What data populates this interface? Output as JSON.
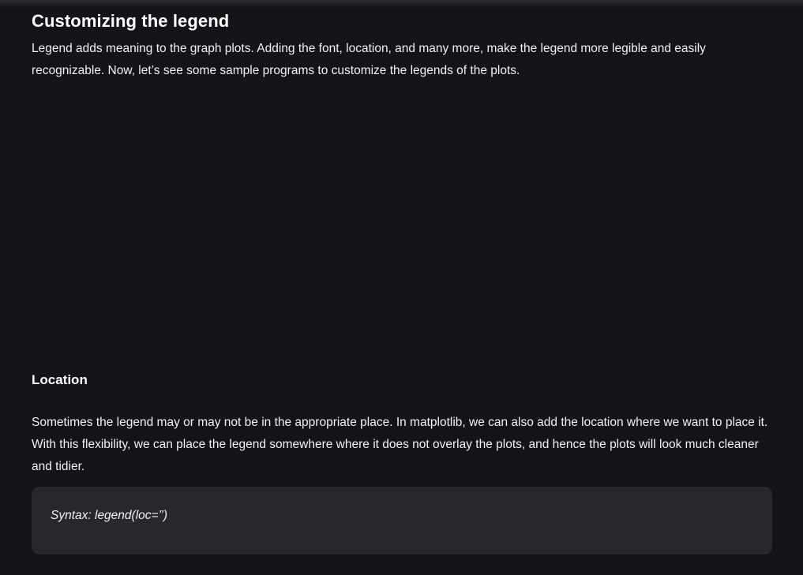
{
  "article": {
    "title": "Customizing the legend",
    "intro": "Legend adds meaning to the graph plots. Adding the font, location, and many more, make the legend more legible and easily recognizable. Now, let’s see some sample programs to customize the legends of the plots.",
    "location_heading": "Location",
    "location_text": "Sometimes the legend may or may not be in the appropriate place. In matplotlib, we can also add the location where we want to place it. With this flexibility, we can place the legend somewhere where it does not overlay the plots, and hence the plots will look much cleaner and tidier.",
    "syntax": "Syntax: legend(loc=’’)"
  }
}
